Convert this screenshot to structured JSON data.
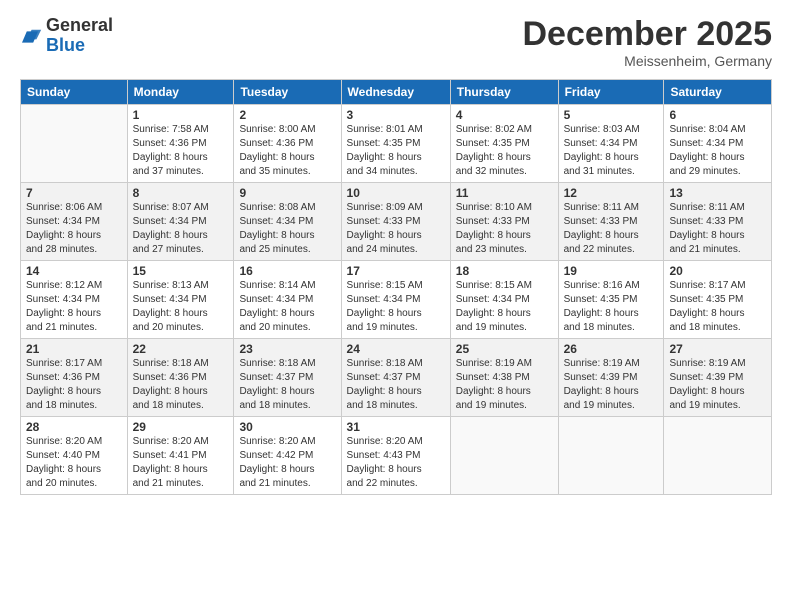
{
  "logo": {
    "general": "General",
    "blue": "Blue"
  },
  "title": "December 2025",
  "location": "Meissenheim, Germany",
  "days_header": [
    "Sunday",
    "Monday",
    "Tuesday",
    "Wednesday",
    "Thursday",
    "Friday",
    "Saturday"
  ],
  "weeks": [
    [
      {
        "num": "",
        "info": ""
      },
      {
        "num": "1",
        "info": "Sunrise: 7:58 AM\nSunset: 4:36 PM\nDaylight: 8 hours\nand 37 minutes."
      },
      {
        "num": "2",
        "info": "Sunrise: 8:00 AM\nSunset: 4:36 PM\nDaylight: 8 hours\nand 35 minutes."
      },
      {
        "num": "3",
        "info": "Sunrise: 8:01 AM\nSunset: 4:35 PM\nDaylight: 8 hours\nand 34 minutes."
      },
      {
        "num": "4",
        "info": "Sunrise: 8:02 AM\nSunset: 4:35 PM\nDaylight: 8 hours\nand 32 minutes."
      },
      {
        "num": "5",
        "info": "Sunrise: 8:03 AM\nSunset: 4:34 PM\nDaylight: 8 hours\nand 31 minutes."
      },
      {
        "num": "6",
        "info": "Sunrise: 8:04 AM\nSunset: 4:34 PM\nDaylight: 8 hours\nand 29 minutes."
      }
    ],
    [
      {
        "num": "7",
        "info": "Sunrise: 8:06 AM\nSunset: 4:34 PM\nDaylight: 8 hours\nand 28 minutes."
      },
      {
        "num": "8",
        "info": "Sunrise: 8:07 AM\nSunset: 4:34 PM\nDaylight: 8 hours\nand 27 minutes."
      },
      {
        "num": "9",
        "info": "Sunrise: 8:08 AM\nSunset: 4:34 PM\nDaylight: 8 hours\nand 25 minutes."
      },
      {
        "num": "10",
        "info": "Sunrise: 8:09 AM\nSunset: 4:33 PM\nDaylight: 8 hours\nand 24 minutes."
      },
      {
        "num": "11",
        "info": "Sunrise: 8:10 AM\nSunset: 4:33 PM\nDaylight: 8 hours\nand 23 minutes."
      },
      {
        "num": "12",
        "info": "Sunrise: 8:11 AM\nSunset: 4:33 PM\nDaylight: 8 hours\nand 22 minutes."
      },
      {
        "num": "13",
        "info": "Sunrise: 8:11 AM\nSunset: 4:33 PM\nDaylight: 8 hours\nand 21 minutes."
      }
    ],
    [
      {
        "num": "14",
        "info": "Sunrise: 8:12 AM\nSunset: 4:34 PM\nDaylight: 8 hours\nand 21 minutes."
      },
      {
        "num": "15",
        "info": "Sunrise: 8:13 AM\nSunset: 4:34 PM\nDaylight: 8 hours\nand 20 minutes."
      },
      {
        "num": "16",
        "info": "Sunrise: 8:14 AM\nSunset: 4:34 PM\nDaylight: 8 hours\nand 20 minutes."
      },
      {
        "num": "17",
        "info": "Sunrise: 8:15 AM\nSunset: 4:34 PM\nDaylight: 8 hours\nand 19 minutes."
      },
      {
        "num": "18",
        "info": "Sunrise: 8:15 AM\nSunset: 4:34 PM\nDaylight: 8 hours\nand 19 minutes."
      },
      {
        "num": "19",
        "info": "Sunrise: 8:16 AM\nSunset: 4:35 PM\nDaylight: 8 hours\nand 18 minutes."
      },
      {
        "num": "20",
        "info": "Sunrise: 8:17 AM\nSunset: 4:35 PM\nDaylight: 8 hours\nand 18 minutes."
      }
    ],
    [
      {
        "num": "21",
        "info": "Sunrise: 8:17 AM\nSunset: 4:36 PM\nDaylight: 8 hours\nand 18 minutes."
      },
      {
        "num": "22",
        "info": "Sunrise: 8:18 AM\nSunset: 4:36 PM\nDaylight: 8 hours\nand 18 minutes."
      },
      {
        "num": "23",
        "info": "Sunrise: 8:18 AM\nSunset: 4:37 PM\nDaylight: 8 hours\nand 18 minutes."
      },
      {
        "num": "24",
        "info": "Sunrise: 8:18 AM\nSunset: 4:37 PM\nDaylight: 8 hours\nand 18 minutes."
      },
      {
        "num": "25",
        "info": "Sunrise: 8:19 AM\nSunset: 4:38 PM\nDaylight: 8 hours\nand 19 minutes."
      },
      {
        "num": "26",
        "info": "Sunrise: 8:19 AM\nSunset: 4:39 PM\nDaylight: 8 hours\nand 19 minutes."
      },
      {
        "num": "27",
        "info": "Sunrise: 8:19 AM\nSunset: 4:39 PM\nDaylight: 8 hours\nand 19 minutes."
      }
    ],
    [
      {
        "num": "28",
        "info": "Sunrise: 8:20 AM\nSunset: 4:40 PM\nDaylight: 8 hours\nand 20 minutes."
      },
      {
        "num": "29",
        "info": "Sunrise: 8:20 AM\nSunset: 4:41 PM\nDaylight: 8 hours\nand 21 minutes."
      },
      {
        "num": "30",
        "info": "Sunrise: 8:20 AM\nSunset: 4:42 PM\nDaylight: 8 hours\nand 21 minutes."
      },
      {
        "num": "31",
        "info": "Sunrise: 8:20 AM\nSunset: 4:43 PM\nDaylight: 8 hours\nand 22 minutes."
      },
      {
        "num": "",
        "info": ""
      },
      {
        "num": "",
        "info": ""
      },
      {
        "num": "",
        "info": ""
      }
    ]
  ]
}
